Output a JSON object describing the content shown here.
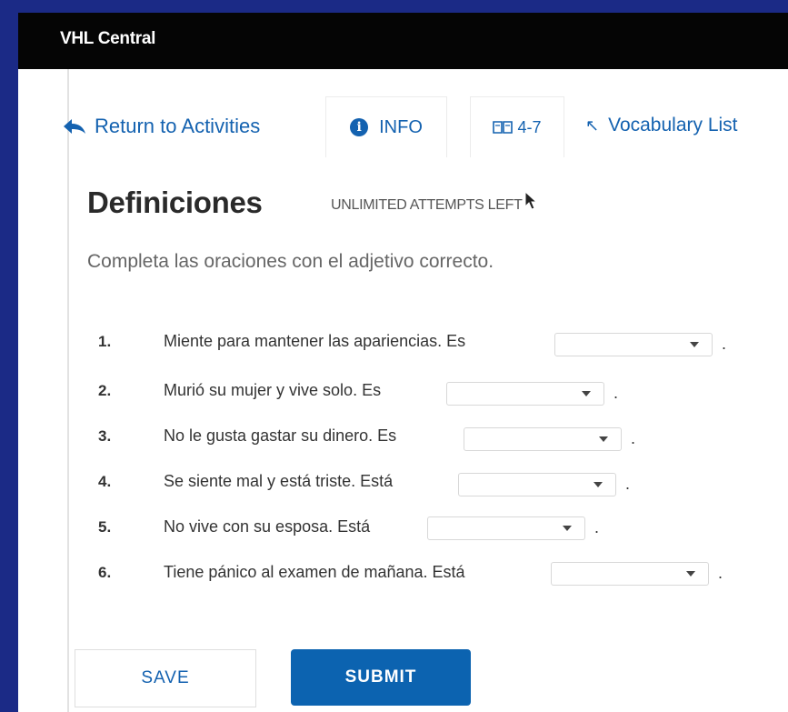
{
  "app": {
    "title": "VHL Central"
  },
  "nav": {
    "return_label": "Return to Activities",
    "info_label": "INFO",
    "book_label": "4-7",
    "vocab_label": "Vocabulary List"
  },
  "activity": {
    "title": "Definiciones",
    "attempts": "UNLIMITED ATTEMPTS LEFT",
    "instructions": "Completa las oraciones con el adjetivo correcto."
  },
  "questions": [
    {
      "num": "1.",
      "text": "Miente para mantener las apariencias. Es",
      "selected": ""
    },
    {
      "num": "2.",
      "text": "Murió su mujer y vive solo. Es",
      "selected": ""
    },
    {
      "num": "3.",
      "text": "No le gusta gastar su dinero. Es",
      "selected": ""
    },
    {
      "num": "4.",
      "text": "Se siente mal y está triste. Está",
      "selected": ""
    },
    {
      "num": "5.",
      "text": "No vive con su esposa. Está",
      "selected": ""
    },
    {
      "num": "6.",
      "text": "Tiene pánico al examen de mañana. Está",
      "selected": ""
    }
  ],
  "punctuation": ".",
  "buttons": {
    "save": "SAVE",
    "submit": "SUBMIT"
  },
  "colors": {
    "accent": "#1462b0",
    "submit_bg": "#0c63b0",
    "topbar": "#050505",
    "outer_bg": "#1b2a86"
  },
  "icons": [
    "reply-arrow-icon",
    "info-icon",
    "book-icon",
    "external-arrow-icon",
    "mouse-cursor-icon",
    "dropdown-caret-icon"
  ]
}
